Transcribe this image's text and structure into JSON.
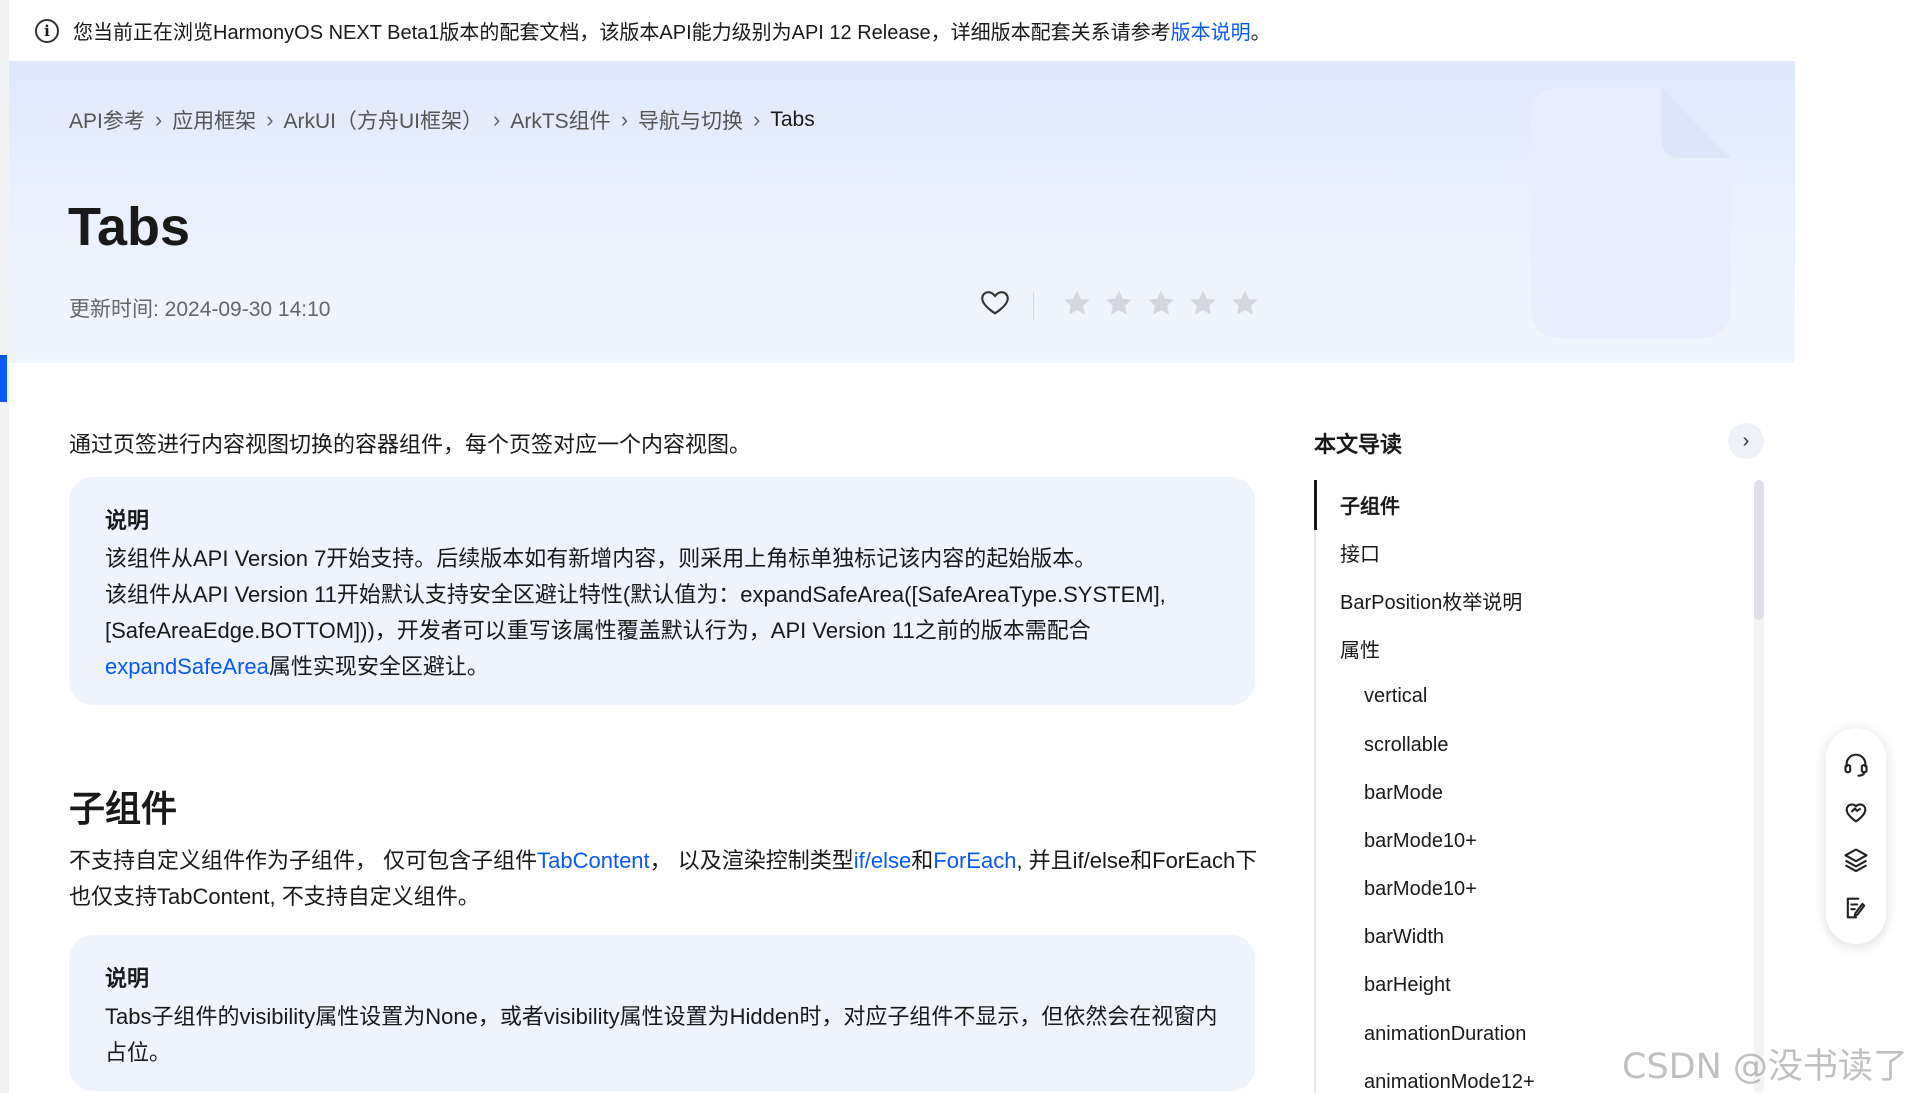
{
  "notice": {
    "text": "您当前正在浏览HarmonyOS NEXT Beta1版本的配套文档，该版本API能力级别为API 12 Release，详细版本配套关系请参考",
    "link": "版本说明",
    "suffix": "。"
  },
  "breadcrumb": [
    "API参考",
    "应用框架",
    "ArkUI（方舟UI框架）",
    "ArkTS组件",
    "导航与切换",
    "Tabs"
  ],
  "page": {
    "title": "Tabs",
    "updated": "更新时间: 2024-09-30 14:10"
  },
  "rating": {
    "stars_filled": 0,
    "stars_total": 5
  },
  "content": {
    "intro": "通过页签进行内容视图切换的容器组件，每个页签对应一个内容视图。",
    "note1": {
      "label": "说明",
      "line1": "该组件从API Version 7开始支持。后续版本如有新增内容，则采用上角标单独标记该内容的起始版本。",
      "line2a": "该组件从API Version 11开始默认支持安全区避让特性(默认值为：expandSafeArea([SafeAreaType.SYSTEM], [SafeAreaEdge.BOTTOM]))，开发者可以重写该属性覆盖默认行为，API Version 11之前的版本需配合",
      "line2link": "expandSafeArea",
      "line2b": "属性实现安全区避让。"
    },
    "section": {
      "title": "子组件",
      "desc_a": "不支持自定义组件作为子组件， 仅可包含子组件",
      "link1": "TabContent",
      "desc_b": "， 以及渲染控制类型",
      "link2": "if/else",
      "desc_c": "和",
      "link3": "ForEach",
      "desc_d": ", 并且if/else和ForEach下也仅支持TabContent, 不支持自定义组件。"
    },
    "note2": {
      "label": "说明",
      "text": "Tabs子组件的visibility属性设置为None，或者visibility属性设置为Hidden时，对应子组件不显示，但依然会在视窗内占位。"
    }
  },
  "toc": {
    "title": "本文导读",
    "items": [
      {
        "label": "子组件",
        "level": 1,
        "active": true
      },
      {
        "label": "接口",
        "level": 1
      },
      {
        "label": "BarPosition枚举说明",
        "level": 1
      },
      {
        "label": "属性",
        "level": 1
      },
      {
        "label": "vertical",
        "level": 2
      },
      {
        "label": "scrollable",
        "level": 2
      },
      {
        "label": "barMode",
        "level": 2
      },
      {
        "label": "barMode10+",
        "level": 2
      },
      {
        "label": "barMode10+",
        "level": 2
      },
      {
        "label": "barWidth",
        "level": 2
      },
      {
        "label": "barHeight",
        "level": 2
      },
      {
        "label": "animationDuration",
        "level": 2
      },
      {
        "label": "animationMode12+",
        "level": 2
      }
    ]
  },
  "floatbar": [
    "headset-icon",
    "heart-handshake-icon",
    "layers-icon",
    "feedback-edit-icon"
  ],
  "watermark": "CSDN @没书读了",
  "colors": {
    "link": "#0a59f7",
    "note_bg": "#eef3fd",
    "hero_bg": "#dfe8fb"
  }
}
